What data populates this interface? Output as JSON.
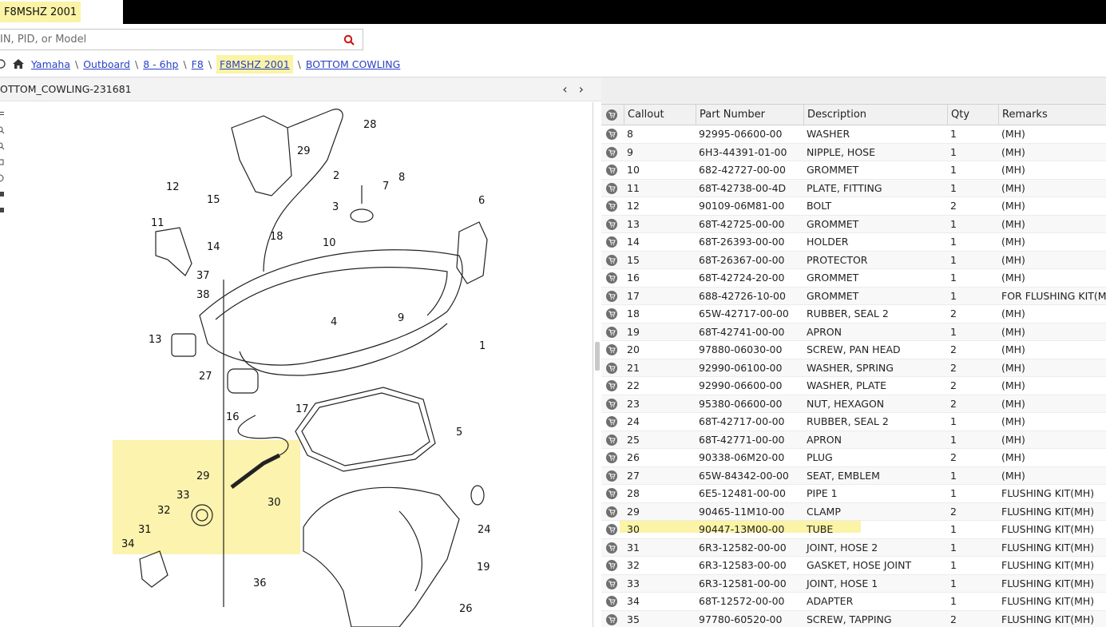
{
  "tab": {
    "label": "F8MSHZ 2001"
  },
  "search": {
    "placeholder": "IN, PID, or Model"
  },
  "breadcrumb": {
    "items": [
      "Yamaha",
      "Outboard",
      "8 - 6hp",
      "F8",
      "F8MSHZ 2001",
      "BOTTOM COWLING"
    ],
    "separator": "\\"
  },
  "diagram": {
    "title": "OTTOM_COWLING-231681"
  },
  "table": {
    "headers": {
      "callout": "Callout",
      "part_number": "Part Number",
      "description": "Description",
      "qty": "Qty",
      "remarks": "Remarks"
    },
    "rows": [
      {
        "callout": "8",
        "part": "92995-06600-00",
        "desc": "WASHER",
        "qty": "1",
        "remarks": "(MH)"
      },
      {
        "callout": "9",
        "part": "6H3-44391-01-00",
        "desc": "NIPPLE, HOSE",
        "qty": "1",
        "remarks": "(MH)"
      },
      {
        "callout": "10",
        "part": "682-42727-00-00",
        "desc": "GROMMET",
        "qty": "1",
        "remarks": "(MH)"
      },
      {
        "callout": "11",
        "part": "68T-42738-00-4D",
        "desc": "PLATE, FITTING",
        "qty": "1",
        "remarks": "(MH)"
      },
      {
        "callout": "12",
        "part": "90109-06M81-00",
        "desc": "BOLT",
        "qty": "2",
        "remarks": "(MH)"
      },
      {
        "callout": "13",
        "part": "68T-42725-00-00",
        "desc": "GROMMET",
        "qty": "1",
        "remarks": "(MH)"
      },
      {
        "callout": "14",
        "part": "68T-26393-00-00",
        "desc": "HOLDER",
        "qty": "1",
        "remarks": "(MH)"
      },
      {
        "callout": "15",
        "part": "68T-26367-00-00",
        "desc": "PROTECTOR",
        "qty": "1",
        "remarks": "(MH)"
      },
      {
        "callout": "16",
        "part": "68T-42724-20-00",
        "desc": "GROMMET",
        "qty": "1",
        "remarks": "(MH)"
      },
      {
        "callout": "17",
        "part": "688-42726-10-00",
        "desc": "GROMMET",
        "qty": "1",
        "remarks": "FOR FLUSHING KIT(MH"
      },
      {
        "callout": "18",
        "part": "65W-42717-00-00",
        "desc": "RUBBER, SEAL 2",
        "qty": "2",
        "remarks": "(MH)"
      },
      {
        "callout": "19",
        "part": "68T-42741-00-00",
        "desc": "APRON",
        "qty": "1",
        "remarks": "(MH)"
      },
      {
        "callout": "20",
        "part": "97880-06030-00",
        "desc": "SCREW, PAN HEAD",
        "qty": "2",
        "remarks": "(MH)"
      },
      {
        "callout": "21",
        "part": "92990-06100-00",
        "desc": "WASHER, SPRING",
        "qty": "2",
        "remarks": "(MH)"
      },
      {
        "callout": "22",
        "part": "92990-06600-00",
        "desc": "WASHER, PLATE",
        "qty": "2",
        "remarks": "(MH)"
      },
      {
        "callout": "23",
        "part": "95380-06600-00",
        "desc": "NUT, HEXAGON",
        "qty": "2",
        "remarks": "(MH)"
      },
      {
        "callout": "24",
        "part": "68T-42717-00-00",
        "desc": "RUBBER, SEAL 2",
        "qty": "1",
        "remarks": "(MH)"
      },
      {
        "callout": "25",
        "part": "68T-42771-00-00",
        "desc": "APRON",
        "qty": "1",
        "remarks": "(MH)"
      },
      {
        "callout": "26",
        "part": "90338-06M20-00",
        "desc": "PLUG",
        "qty": "2",
        "remarks": "(MH)"
      },
      {
        "callout": "27",
        "part": "65W-84342-00-00",
        "desc": "SEAT, EMBLEM",
        "qty": "1",
        "remarks": "(MH)"
      },
      {
        "callout": "28",
        "part": "6E5-12481-00-00",
        "desc": "PIPE 1",
        "qty": "1",
        "remarks": "FLUSHING KIT(MH)"
      },
      {
        "callout": "29",
        "part": "90465-11M10-00",
        "desc": "CLAMP",
        "qty": "2",
        "remarks": "FLUSHING KIT(MH)"
      },
      {
        "callout": "30",
        "part": "90447-13M00-00",
        "desc": "TUBE",
        "qty": "1",
        "remarks": "FLUSHING KIT(MH)"
      },
      {
        "callout": "31",
        "part": "6R3-12582-00-00",
        "desc": "JOINT, HOSE 2",
        "qty": "1",
        "remarks": "FLUSHING KIT(MH)"
      },
      {
        "callout": "32",
        "part": "6R3-12583-00-00",
        "desc": "GASKET, HOSE JOINT",
        "qty": "1",
        "remarks": "FLUSHING KIT(MH)"
      },
      {
        "callout": "33",
        "part": "6R3-12581-00-00",
        "desc": "JOINT, HOSE 1",
        "qty": "1",
        "remarks": "FLUSHING KIT(MH)"
      },
      {
        "callout": "34",
        "part": "68T-12572-00-00",
        "desc": "ADAPTER",
        "qty": "1",
        "remarks": "FLUSHING KIT(MH)"
      },
      {
        "callout": "35",
        "part": "97780-60520-00",
        "desc": "SCREW, TAPPING",
        "qty": "2",
        "remarks": "FLUSHING KIT(MH)"
      }
    ]
  },
  "diagram_callouts": [
    "28",
    "29",
    "2",
    "7",
    "8",
    "3",
    "6",
    "12",
    "15",
    "11",
    "18",
    "10",
    "14",
    "37",
    "38",
    "4",
    "9",
    "1",
    "13",
    "27",
    "16",
    "17",
    "5",
    "29",
    "33",
    "30",
    "32",
    "31",
    "34",
    "24",
    "19",
    "36",
    "26"
  ],
  "colors": {
    "highlight": "#fbf3a6",
    "link": "#2a41c7",
    "search_icon": "#cc1111"
  }
}
